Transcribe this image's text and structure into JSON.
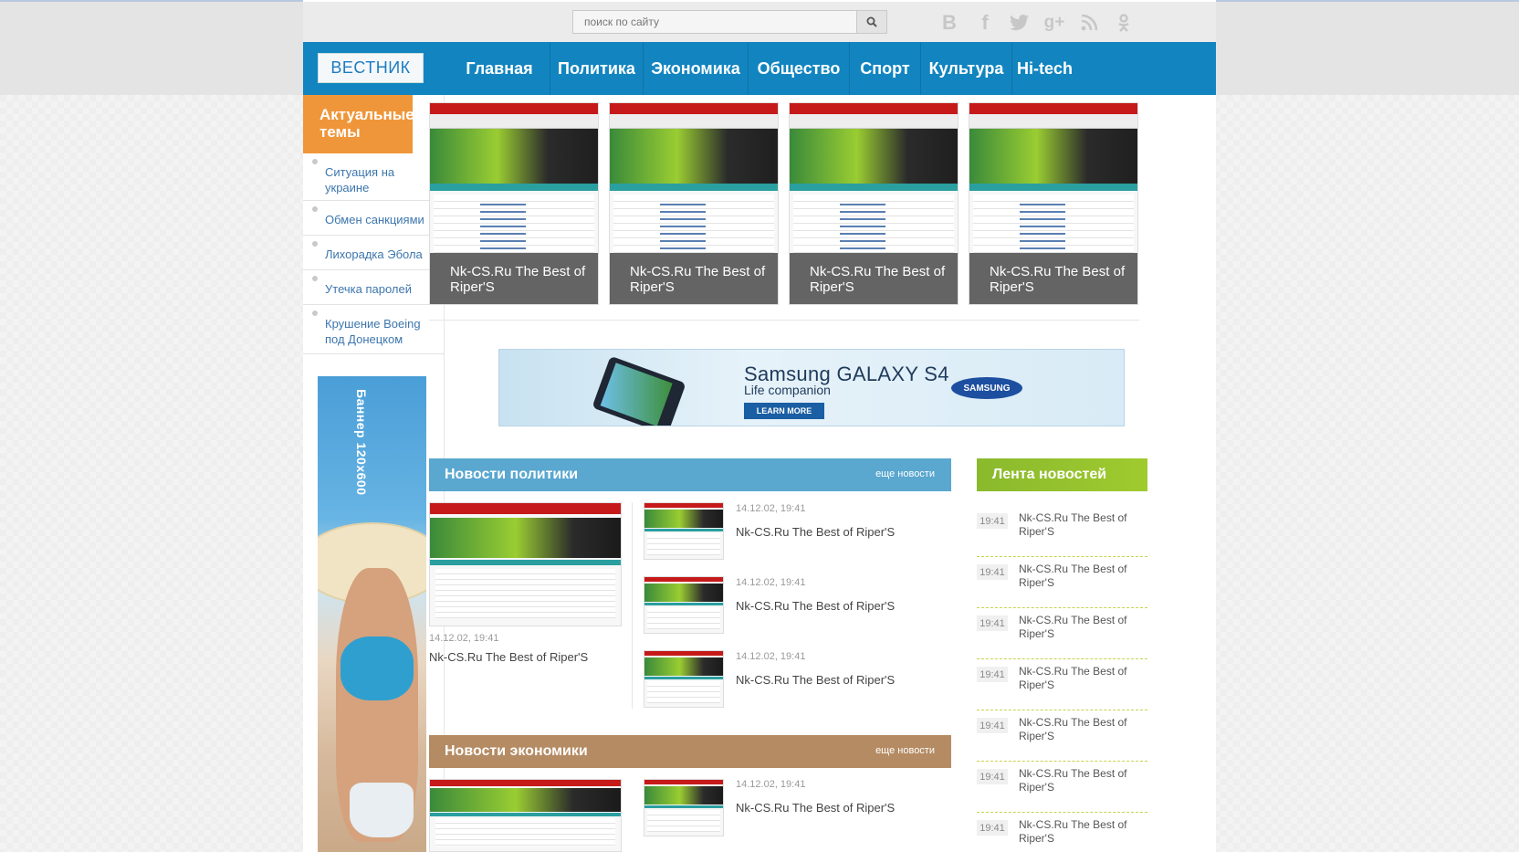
{
  "search": {
    "placeholder": "поиск по сайту"
  },
  "social": [
    "vk-icon",
    "facebook-icon",
    "twitter-icon",
    "googleplus-icon",
    "rss-icon",
    "odnoklassniki-icon"
  ],
  "logo": "ВЕСТНИК",
  "nav": [
    "Главная",
    "Политика",
    "Экономика",
    "Общество",
    "Спорт",
    "Культура",
    "Hi-tech"
  ],
  "sidebar": {
    "heading": "Актуальные темы",
    "topics": [
      "Ситуация на украине",
      "Обмен санкциями",
      "Лихорадка Эбола",
      "Утечка паролей",
      "Крушение Boeing под Донецком"
    ],
    "banner_text": "Баннер 120x600"
  },
  "featured": [
    {
      "title": "Nk-CS.Ru The Best of Riper'S"
    },
    {
      "title": "Nk-CS.Ru The Best of Riper'S"
    },
    {
      "title": "Nk-CS.Ru The Best of Riper'S"
    },
    {
      "title": "Nk-CS.Ru The Best of Riper'S"
    }
  ],
  "ad": {
    "brand_line": "Samsung GALAXY S4",
    "sub": "Life companion",
    "cta": "LEARN MORE",
    "logo": "SAMSUNG"
  },
  "politics": {
    "heading": "Новости политики",
    "more": "еще новости",
    "main": {
      "date": "14.12.02, 19:41",
      "title": "Nk-CS.Ru The Best of Riper'S"
    },
    "items": [
      {
        "date": "14.12.02, 19:41",
        "title": "Nk-CS.Ru The Best of Riper'S"
      },
      {
        "date": "14.12.02, 19:41",
        "title": "Nk-CS.Ru The Best of Riper'S"
      },
      {
        "date": "14.12.02, 19:41",
        "title": "Nk-CS.Ru The Best of Riper'S"
      }
    ]
  },
  "economy": {
    "heading": "Новости экономики",
    "more": "еще новости",
    "items": [
      {
        "date": "14.12.02, 19:41",
        "title": "Nk-CS.Ru The Best of Riper'S"
      }
    ]
  },
  "feed": {
    "heading": "Лента новостей",
    "items": [
      {
        "time": "19:41",
        "text": "Nk-CS.Ru The Best of Riper'S"
      },
      {
        "time": "19:41",
        "text": "Nk-CS.Ru The Best of Riper'S"
      },
      {
        "time": "19:41",
        "text": "Nk-CS.Ru The Best of Riper'S"
      },
      {
        "time": "19:41",
        "text": "Nk-CS.Ru The Best of Riper'S"
      },
      {
        "time": "19:41",
        "text": "Nk-CS.Ru The Best of Riper'S"
      },
      {
        "time": "19:41",
        "text": "Nk-CS.Ru The Best of Riper'S"
      },
      {
        "time": "19:41",
        "text": "Nk-CS.Ru The Best of Riper'S"
      }
    ]
  },
  "colors": {
    "nav": "#1285c0",
    "topics": "#f0963a",
    "politics": "#5aa7d0",
    "economy": "#b58b63",
    "feed": "#8ab92d"
  }
}
